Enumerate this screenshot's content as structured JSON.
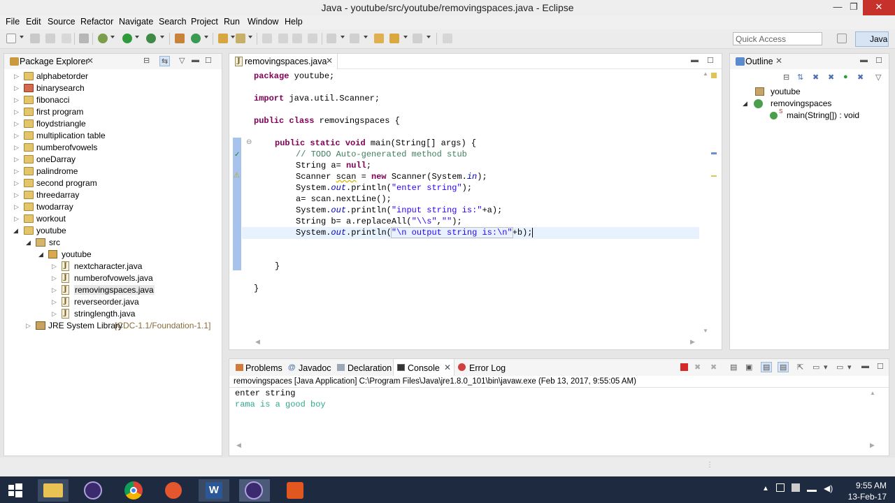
{
  "window": {
    "title": "Java - youtube/src/youtube/removingspaces.java - Eclipse",
    "minimize": "—",
    "maximize": "❐",
    "close": "✕"
  },
  "menu": [
    "File",
    "Edit",
    "Source",
    "Refactor",
    "Navigate",
    "Search",
    "Project",
    "Run",
    "Window",
    "Help"
  ],
  "toolbar": {
    "quick_access_placeholder": "Quick Access",
    "perspective": "Java"
  },
  "package_explorer": {
    "title": "Package Explorer",
    "projects": [
      "alphabetorder",
      "binarysearch",
      "fibonacci",
      "first program",
      "floydstriangle",
      "multiplication table",
      "numberofvowels",
      "oneDarray",
      "palindrome",
      "second program",
      "threedarray",
      "twodarray",
      "workout",
      "youtube"
    ],
    "src": "src",
    "package": "youtube",
    "files": [
      "nextcharacter.java",
      "numberofvowels.java",
      "removingspaces.java",
      "reverseorder.java",
      "stringlength.java"
    ],
    "jre": "JRE System Library",
    "jre_version": "[CDC-1.1/Foundation-1.1]"
  },
  "editor": {
    "tab": "removingspaces.java",
    "lines": {
      "l1": [
        "package",
        " youtube;"
      ],
      "l2": [
        "import",
        " java.util.Scanner;"
      ],
      "l3": [
        "public",
        " ",
        "class",
        " removingspaces {"
      ],
      "l4": [
        "public",
        " ",
        "static",
        " ",
        "void",
        " main(String[] args) {"
      ],
      "l5": "// TODO Auto-generated method stub",
      "l6": [
        "String a= ",
        "null",
        ";"
      ],
      "l7": [
        "Scanner ",
        "scan",
        " = ",
        "new",
        " Scanner(System.",
        "in",
        ");"
      ],
      "l8": [
        "System.",
        "out",
        ".println(",
        "\"enter string\"",
        ");"
      ],
      "l9": "a= scan.nextLine();",
      "l10": [
        "System.",
        "out",
        ".println(",
        "\"input string is:\"",
        "+a);"
      ],
      "l11": [
        "String b= a.replaceAll(",
        "\"\\\\s\"",
        ",",
        "\"\"",
        ");"
      ],
      "l12": [
        "System.",
        "out",
        ".println(",
        "\"\\n output string is:\\n\"",
        "+b);"
      ],
      "l13": "}",
      "l14": "}"
    }
  },
  "outline": {
    "title": "Outline",
    "package": "youtube",
    "class": "removingspaces",
    "method": "main(String[]) : void"
  },
  "bottom": {
    "tabs": [
      "Problems",
      "Javadoc",
      "Declaration",
      "Console",
      "Error Log"
    ],
    "active_tab": "Console",
    "launch": "removingspaces [Java Application] C:\\Program Files\\Java\\jre1.8.0_101\\bin\\javaw.exe (Feb 13, 2017, 9:55:05 AM)",
    "output": [
      "enter string",
      "rama is a good boy"
    ]
  },
  "taskbar": {
    "time": "9:55 AM",
    "date": "13-Feb-17"
  },
  "colors": {
    "keyword": "#7f0055",
    "comment": "#3f7f5f",
    "string": "#2a00ff",
    "field": "#0000c0",
    "console_input": "#2eab8b"
  }
}
